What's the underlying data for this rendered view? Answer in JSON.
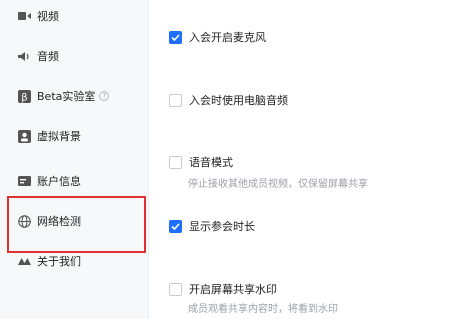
{
  "sidebar": {
    "items": [
      {
        "label": "视频",
        "icon": "video-icon"
      },
      {
        "label": "音频",
        "icon": "speaker-icon"
      },
      {
        "label": "Beta实验室",
        "icon": "beta-lab-icon"
      },
      {
        "label": "虚拟背景",
        "icon": "person-icon"
      },
      {
        "label": "账户信息",
        "icon": "account-card-icon"
      },
      {
        "label": "网络检测",
        "icon": "globe-icon"
      },
      {
        "label": "关于我们",
        "icon": "about-icon"
      }
    ],
    "highlight_color": "#e0322f"
  },
  "options": [
    {
      "label": "入会开启麦克风",
      "checked": true
    },
    {
      "label": "入会时使用电脑音频",
      "checked": false
    },
    {
      "label": "语音模式",
      "checked": false,
      "description": "停止接收其他成员视频，仅保留屏幕共享"
    },
    {
      "label": "显示参会时长",
      "checked": true
    },
    {
      "label": "开启屏幕共享水印",
      "checked": false,
      "description": "成员观看共享内容时，将看到水印"
    }
  ],
  "colors": {
    "accent": "#1e6fff",
    "description_text": "#9aa0a8"
  }
}
